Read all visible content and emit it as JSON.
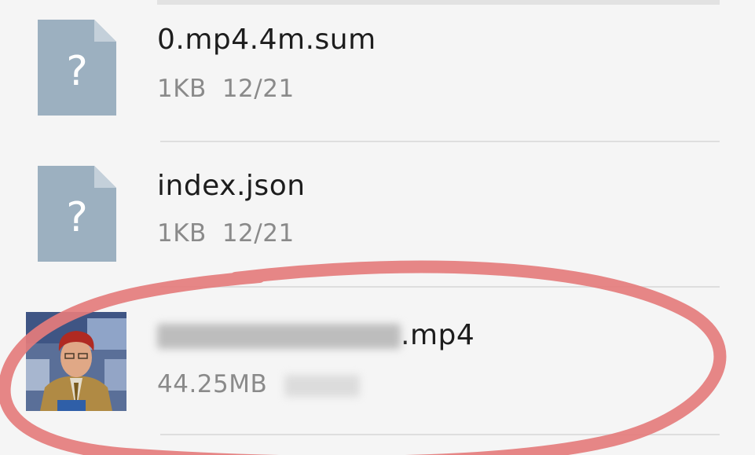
{
  "files": [
    {
      "name": "0.mp4.4m.sum",
      "size": "1KB",
      "date": "12/21",
      "icon": "unknown-file-icon"
    },
    {
      "name": "index.json",
      "size": "1KB",
      "date": "12/21",
      "icon": "unknown-file-icon"
    },
    {
      "name_suffix": ".mp4",
      "size": "44.25MB",
      "icon": "video-thumbnail"
    }
  ],
  "colors": {
    "icon_fill": "#9cb0c0",
    "icon_fold": "#c4d0da",
    "annotation": "#e47c7c",
    "name_text": "#1d1d1d",
    "meta_text": "#8a8a8a"
  }
}
